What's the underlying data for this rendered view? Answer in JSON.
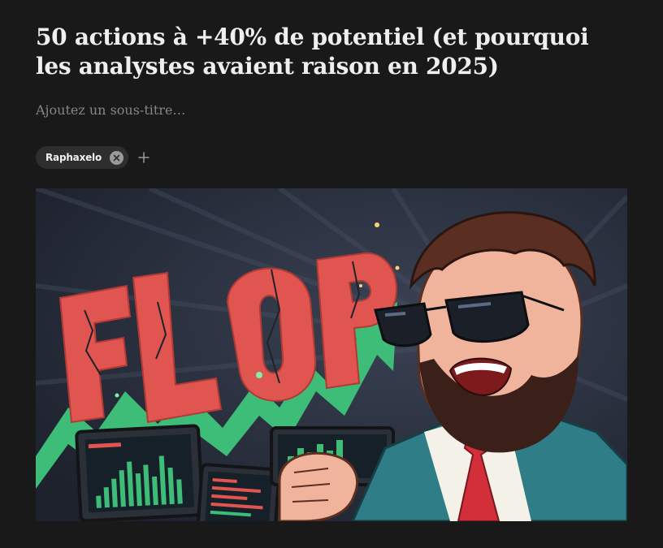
{
  "post": {
    "title": "50 actions à +40% de potentiel (et pourquoi les analystes avaient raison en 2025)",
    "subtitle_placeholder": "Ajoutez un sous-titre…"
  },
  "authors": [
    {
      "name": "Raphaxelo"
    }
  ],
  "cover_image": {
    "headline_text": "FLOP",
    "description": "Cartoon of a bearded man in sunglasses and teal suit shouting, with a green rising arrow and trading screens",
    "colors": {
      "background": "#222835",
      "flop_red": "#e0554f",
      "arrow_green": "#3dbd78",
      "suit_teal": "#2f7d86",
      "tie_red": "#d22f3a"
    }
  },
  "icons": {
    "remove_author": "close-circle-icon",
    "add_author": "plus-icon"
  }
}
